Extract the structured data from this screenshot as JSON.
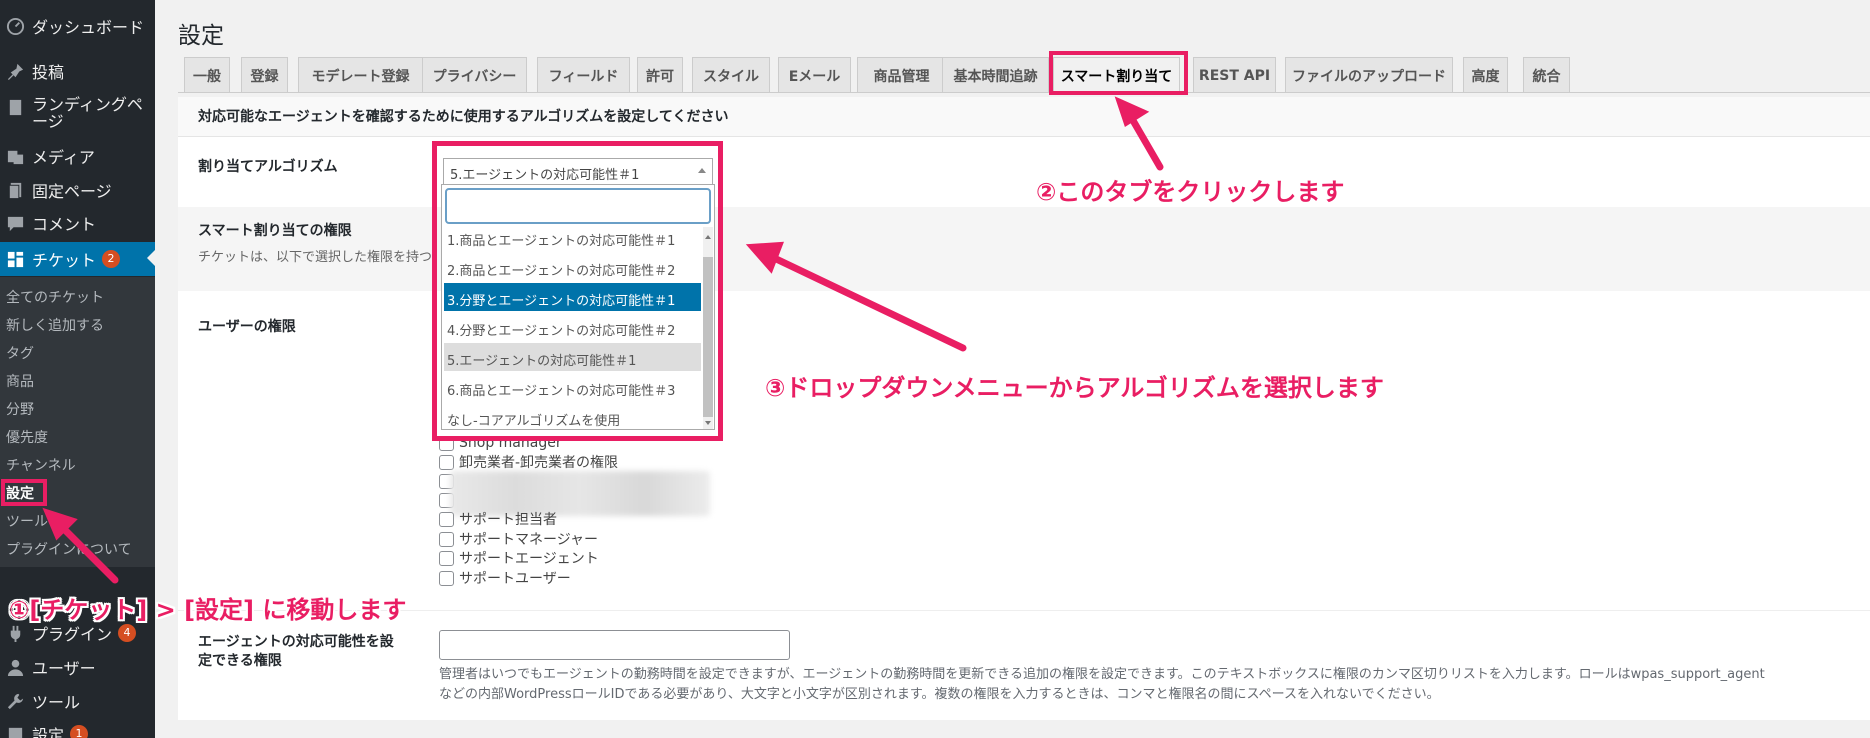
{
  "sidebar": {
    "top_items": [
      {
        "label": "ダッシュボード",
        "icon": "dashboard-icon"
      },
      {
        "label": "投稿",
        "icon": "pin-icon"
      },
      {
        "label": "ランディングページ",
        "icon": "landing-page-icon"
      },
      {
        "label": "メディア",
        "icon": "media-icon"
      },
      {
        "label": "固定ページ",
        "icon": "pages-icon"
      },
      {
        "label": "コメント",
        "icon": "comment-icon"
      },
      {
        "label": "チケット",
        "icon": "ticket-icon",
        "badge": "2",
        "current": true
      }
    ],
    "submenu": [
      "全てのチケット",
      "新しく追加する",
      "タグ",
      "商品",
      "分野",
      "優先度",
      "チャンネル",
      "設定",
      "ツール",
      "プラグインについて"
    ],
    "active_submenu": "設定",
    "bottom_items": [
      {
        "label": "プラグイン",
        "icon": "plugin-icon",
        "badge": "4"
      },
      {
        "label": "ユーザー",
        "icon": "user-icon"
      },
      {
        "label": "ツール",
        "icon": "tools-icon"
      },
      {
        "label": "設定",
        "icon": "settings-icon",
        "badge": "1"
      }
    ]
  },
  "page": {
    "title": "設定"
  },
  "tabs": [
    "一般",
    "登録",
    "モデレート登録",
    "プライバシー",
    "フィールド",
    "許可",
    "スタイル",
    "Eメール",
    "商品管理",
    "基本時間追跡",
    "スマート割り当て",
    "REST API",
    "ファイルのアップロード",
    "高度",
    "統合"
  ],
  "active_tab": "スマート割り当て",
  "form": {
    "intro": "対応可能なエージェントを確認するために使用するアルゴリズムを設定してください",
    "algorithm_label": "割り当てアルゴリズム",
    "smart_perm_label": "スマート割り当ての権限",
    "smart_perm_desc": "チケットは、以下で選択した権限を持つ",
    "user_perm_label": "ユーザーの権限",
    "availability_label_line1": "エージェントの対応可能性を設",
    "availability_label_line2": "定できる権限",
    "availability_help_line1": "管理者はいつでもエージェントの勤務時間を設定できますが、エージェントの勤務時間を更新できる追加の権限を設定できます。このテキストボックスに権限のカンマ区切りリストを入力します。ロールはwpas_support_agent",
    "availability_help_line2": "などの内部WordPressロールIDである必要があり、大文字と小文字が区別されます。複数の権限を入力するときは、コンマと権限名の間にスペースを入れないでください。"
  },
  "roles": [
    "Shop manager",
    "卸売業者-卸売業者の権限",
    "",
    "",
    "サポート担当者",
    "サポートマネージャー",
    "サポートエージェント",
    "サポートユーザー"
  ],
  "dropdown": {
    "selected": "5.エージェントの対応可能性＃1",
    "search_value": "",
    "options": [
      "1.商品とエージェントの対応可能性＃1",
      "2.商品とエージェントの対応可能性＃2",
      "3.分野とエージェントの対応可能性＃1",
      "4.分野とエージェントの対応可能性＃2",
      "5.エージェントの対応可能性＃1",
      "6.商品とエージェントの対応可能性＃3",
      "なし-コアアルゴリズムを使用"
    ],
    "highlighted_index": 2,
    "selected_index": 4
  },
  "callouts": {
    "step1": "①[チケット] > [設定] に移動します",
    "step2": "②このタブをクリックします",
    "step3": "③ドロップダウンメニューからアルゴリズムを選択します"
  },
  "colors": {
    "highlight": "#e91e63",
    "wp_blue": "#0073aa",
    "sidebar": "#23282d",
    "badge": "#d54e21"
  }
}
